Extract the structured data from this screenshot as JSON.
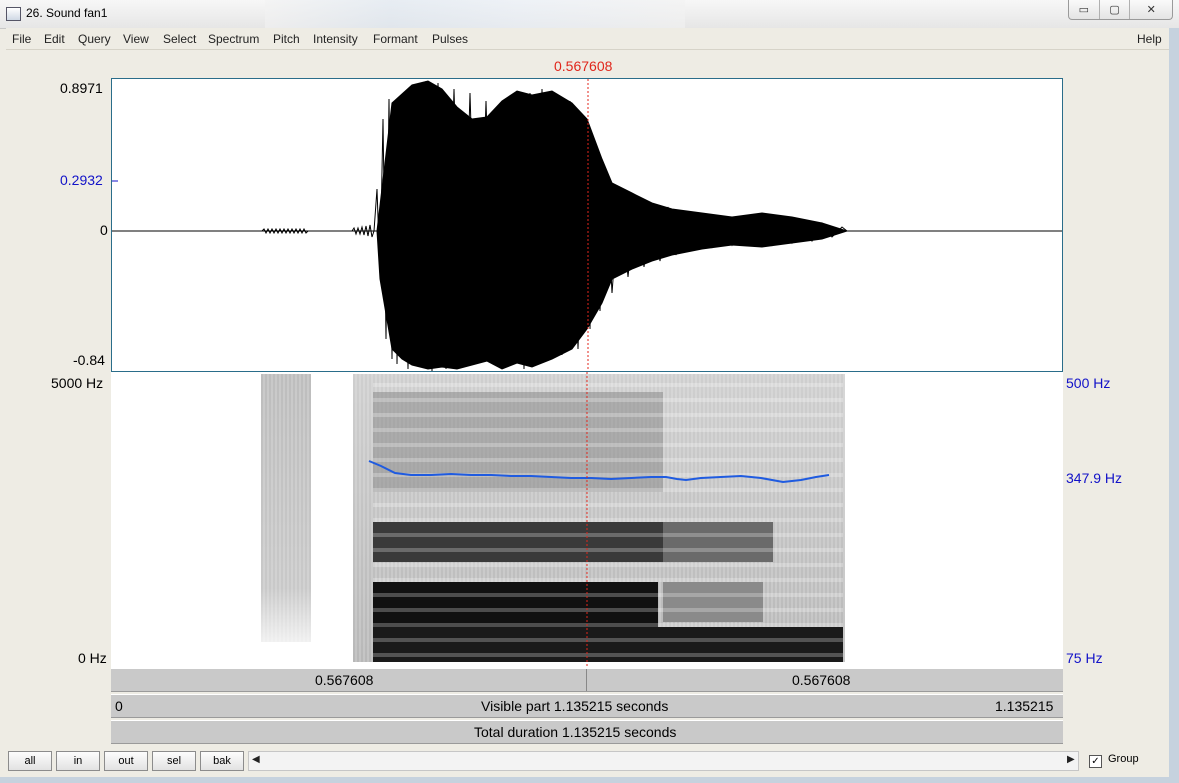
{
  "window": {
    "title": "26. Sound fan1"
  },
  "caption_buttons": {
    "minimize": "▭",
    "maximize": "▢",
    "close": "✕"
  },
  "menu": [
    "File",
    "Edit",
    "Query",
    "View",
    "Select",
    "Spectrum",
    "Pitch",
    "Intensity",
    "Formant",
    "Pulses"
  ],
  "help_label": "Help",
  "cursor_time_top": "0.567608",
  "waveform": {
    "y_max": "0.8971",
    "y_mid": "0.2932",
    "y_zero": "0",
    "y_min": "-0.84"
  },
  "spectrogram": {
    "freq_top": "5000 Hz",
    "freq_bottom": "0 Hz",
    "pitch_top": "500 Hz",
    "pitch_current": "347.9 Hz",
    "pitch_bottom": "75 Hz"
  },
  "time_bar": {
    "left": "0.567608",
    "right": "0.567608"
  },
  "visible_bar": {
    "start": "0",
    "label": "Visible part 1.135215 seconds",
    "end": "1.135215"
  },
  "total_bar": {
    "label": "Total duration 1.135215 seconds"
  },
  "buttons": {
    "all": "all",
    "in": "in",
    "out": "out",
    "sel": "sel",
    "bak": "bak"
  },
  "scroll": {
    "left_arrow": "◀",
    "right_arrow": "▶"
  },
  "group": {
    "label": "Group",
    "checked": "✓"
  },
  "colors": {
    "cursor": "#e0261b",
    "pitch_curve": "#1f5be0",
    "axis_blue": "#1212c8"
  }
}
